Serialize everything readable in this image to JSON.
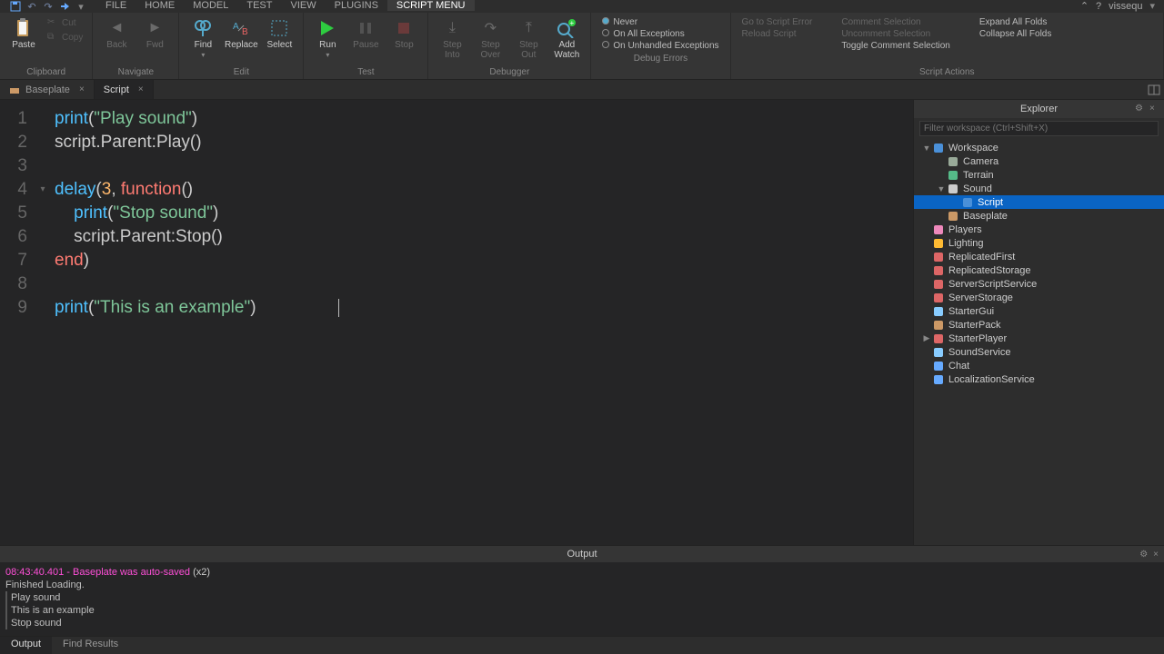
{
  "menubar": {
    "items": [
      "FILE",
      "HOME",
      "MODEL",
      "TEST",
      "VIEW",
      "PLUGINS",
      "SCRIPT MENU"
    ],
    "active": 6,
    "username": "vissequ"
  },
  "ribbon": {
    "clipboard": {
      "paste": "Paste",
      "cut": "Cut",
      "copy": "Copy",
      "label": "Clipboard"
    },
    "navigate": {
      "back": "Back",
      "fwd": "Fwd",
      "label": "Navigate"
    },
    "edit": {
      "find": "Find",
      "replace": "Replace",
      "select": "Select",
      "label": "Edit"
    },
    "test": {
      "run": "Run",
      "pause": "Pause",
      "stop": "Stop",
      "label": "Test"
    },
    "debugger": {
      "stepInto": "Step\nInto",
      "stepOver": "Step\nOver",
      "stepOut": "Step\nOut",
      "addWatch": "Add\nWatch",
      "label": "Debugger"
    },
    "errors": {
      "never": "Never",
      "all": "On All Exceptions",
      "unhandled": "On Unhandled Exceptions",
      "label": "Debug Errors"
    },
    "scriptActions": {
      "goto": "Go to Script Error",
      "reload": "Reload Script",
      "comment": "Comment Selection",
      "uncomment": "Uncomment Selection",
      "toggle": "Toggle Comment Selection",
      "expand": "Expand All Folds",
      "collapse": "Collapse All Folds",
      "label": "Script Actions"
    }
  },
  "tabs": {
    "baseplate": "Baseplate",
    "script": "Script"
  },
  "code": {
    "lines": [
      [
        {
          "c": "tk-fn",
          "t": "print"
        },
        {
          "c": "tk-punc",
          "t": "("
        },
        {
          "c": "tk-str",
          "t": "\"Play sound\""
        },
        {
          "c": "tk-punc",
          "t": ")"
        }
      ],
      [
        {
          "c": "tk-punc",
          "t": "script"
        },
        {
          "c": "tk-punc",
          "t": ".Parent:"
        },
        {
          "c": "tk-punc",
          "t": "Play()"
        }
      ],
      [],
      [
        {
          "c": "tk-fn",
          "t": "delay"
        },
        {
          "c": "tk-punc",
          "t": "("
        },
        {
          "c": "tk-num",
          "t": "3"
        },
        {
          "c": "tk-punc",
          "t": ", "
        },
        {
          "c": "tk-kw",
          "t": "function"
        },
        {
          "c": "tk-punc",
          "t": "()"
        }
      ],
      [
        {
          "c": "",
          "t": "    "
        },
        {
          "c": "tk-fn",
          "t": "print"
        },
        {
          "c": "tk-punc",
          "t": "("
        },
        {
          "c": "tk-str",
          "t": "\"Stop sound\""
        },
        {
          "c": "tk-punc",
          "t": ")"
        }
      ],
      [
        {
          "c": "",
          "t": "    "
        },
        {
          "c": "tk-punc",
          "t": "script.Parent:Stop()"
        }
      ],
      [
        {
          "c": "tk-kw",
          "t": "end"
        },
        {
          "c": "tk-punc",
          "t": ")"
        }
      ],
      [],
      [
        {
          "c": "tk-fn",
          "t": "print"
        },
        {
          "c": "tk-punc",
          "t": "("
        },
        {
          "c": "tk-str",
          "t": "\"This is an example\""
        },
        {
          "c": "tk-punc",
          "t": ")"
        }
      ]
    ],
    "foldAt": 4
  },
  "explorer": {
    "title": "Explorer",
    "filterPlaceholder": "Filter workspace (Ctrl+Shift+X)",
    "tree": [
      {
        "indent": 0,
        "arrow": "▼",
        "icon": "globe",
        "color": "#4a90d9",
        "label": "Workspace"
      },
      {
        "indent": 1,
        "arrow": "",
        "icon": "camera",
        "color": "#9a9",
        "label": "Camera"
      },
      {
        "indent": 1,
        "arrow": "",
        "icon": "terrain",
        "color": "#5b8",
        "label": "Terrain"
      },
      {
        "indent": 1,
        "arrow": "▼",
        "icon": "sound",
        "color": "#ccc",
        "label": "Sound"
      },
      {
        "indent": 2,
        "arrow": "",
        "icon": "script",
        "color": "#4a90d9",
        "label": "Script",
        "selected": true
      },
      {
        "indent": 1,
        "arrow": "",
        "icon": "part",
        "color": "#c96",
        "label": "Baseplate"
      },
      {
        "indent": 0,
        "arrow": "",
        "icon": "players",
        "color": "#e8b",
        "label": "Players"
      },
      {
        "indent": 0,
        "arrow": "",
        "icon": "light",
        "color": "#fb3",
        "label": "Lighting"
      },
      {
        "indent": 0,
        "arrow": "",
        "icon": "folder",
        "color": "#d66",
        "label": "ReplicatedFirst"
      },
      {
        "indent": 0,
        "arrow": "",
        "icon": "folder",
        "color": "#d66",
        "label": "ReplicatedStorage"
      },
      {
        "indent": 0,
        "arrow": "",
        "icon": "folder",
        "color": "#d66",
        "label": "ServerScriptService"
      },
      {
        "indent": 0,
        "arrow": "",
        "icon": "folder",
        "color": "#d66",
        "label": "ServerStorage"
      },
      {
        "indent": 0,
        "arrow": "",
        "icon": "gui",
        "color": "#8cf",
        "label": "StarterGui"
      },
      {
        "indent": 0,
        "arrow": "",
        "icon": "pack",
        "color": "#c96",
        "label": "StarterPack"
      },
      {
        "indent": 0,
        "arrow": "▶",
        "icon": "player",
        "color": "#d66",
        "label": "StarterPlayer"
      },
      {
        "indent": 0,
        "arrow": "",
        "icon": "sound",
        "color": "#8cf",
        "label": "SoundService"
      },
      {
        "indent": 0,
        "arrow": "",
        "icon": "chat",
        "color": "#6af",
        "label": "Chat"
      },
      {
        "indent": 0,
        "arrow": "",
        "icon": "globe",
        "color": "#6af",
        "label": "LocalizationService"
      }
    ]
  },
  "output": {
    "title": "Output",
    "autosave_time": "08:43:40.401",
    "autosave_msg": " - Baseplate was auto-saved ",
    "autosave_count": "(x2)",
    "lines": [
      "Finished Loading.",
      "Play sound",
      "This is an example",
      "Stop sound"
    ],
    "tabs": {
      "output": "Output",
      "find": "Find Results"
    }
  }
}
